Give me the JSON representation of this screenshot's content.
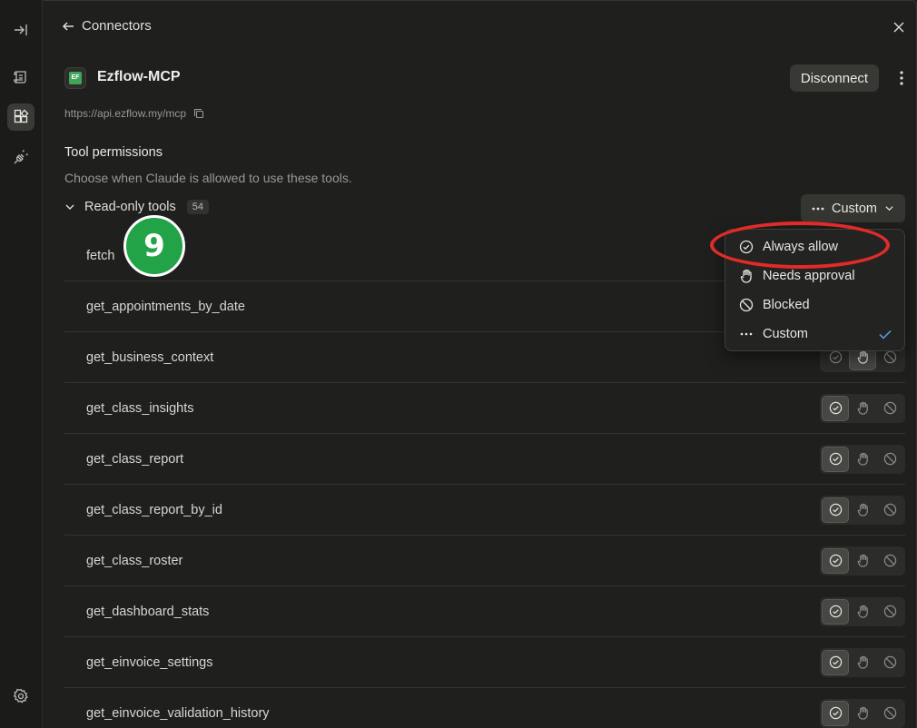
{
  "header": {
    "back_label": "Connectors"
  },
  "server": {
    "name": "Ezflow-MCP",
    "icon_text": "EF",
    "url": "https://api.ezflow.my/mcp",
    "disconnect_label": "Disconnect"
  },
  "permissions": {
    "title": "Tool permissions",
    "description": "Choose when Claude is allowed to use these tools.",
    "group_label": "Read-only tools",
    "group_count": "54",
    "mode_label": "Custom"
  },
  "menu": {
    "items": [
      {
        "label": "Always allow",
        "icon": "check-circle-icon"
      },
      {
        "label": "Needs approval",
        "icon": "hand-icon"
      },
      {
        "label": "Blocked",
        "icon": "block-icon"
      },
      {
        "label": "Custom",
        "icon": "ellipsis-icon",
        "selected": true
      }
    ]
  },
  "tools": [
    {
      "name": "fetch",
      "state": "allow"
    },
    {
      "name": "get_appointments_by_date",
      "state": "allow"
    },
    {
      "name": "get_business_context",
      "state": "approval"
    },
    {
      "name": "get_class_insights",
      "state": "allow"
    },
    {
      "name": "get_class_report",
      "state": "allow"
    },
    {
      "name": "get_class_report_by_id",
      "state": "allow"
    },
    {
      "name": "get_class_roster",
      "state": "allow"
    },
    {
      "name": "get_dashboard_stats",
      "state": "allow"
    },
    {
      "name": "get_einvoice_settings",
      "state": "allow"
    },
    {
      "name": "get_einvoice_validation_history",
      "state": "allow"
    }
  ],
  "annotation": {
    "step_number": "9"
  },
  "colors": {
    "accent_check": "#5b8fd9",
    "annotation_ring": "#e12b28",
    "annotation_badge": "#23a348"
  }
}
